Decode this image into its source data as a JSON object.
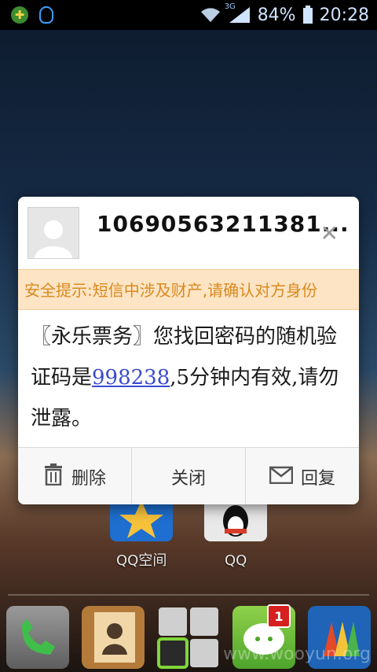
{
  "status_bar": {
    "battery_percent": "84%",
    "time": "20:28",
    "network_type": "3G",
    "icons": [
      "notification-app-icon",
      "qq-icon",
      "wifi-icon",
      "signal-icon",
      "battery-icon"
    ]
  },
  "dialog": {
    "sender": "10690563211381...",
    "warning": "安全提示:短信中涉及财产,请确认对方身份",
    "message_part1": "〖永乐票务〗您找回密码的随机验证码是",
    "code": "998238",
    "message_part2": ",5分钟内有效,请勿泄露。",
    "actions": {
      "delete_label": "删除",
      "close_label": "关闭",
      "reply_label": "回复"
    }
  },
  "home": {
    "apps": [
      "QQ空间",
      "QQ"
    ]
  },
  "watermark": "www.wooyun.org",
  "dock": {
    "messages_badge": "1"
  },
  "colors": {
    "warning_bg": "#fde4c4",
    "warning_text": "#d98a1e",
    "code_link": "#3a4bd1"
  }
}
